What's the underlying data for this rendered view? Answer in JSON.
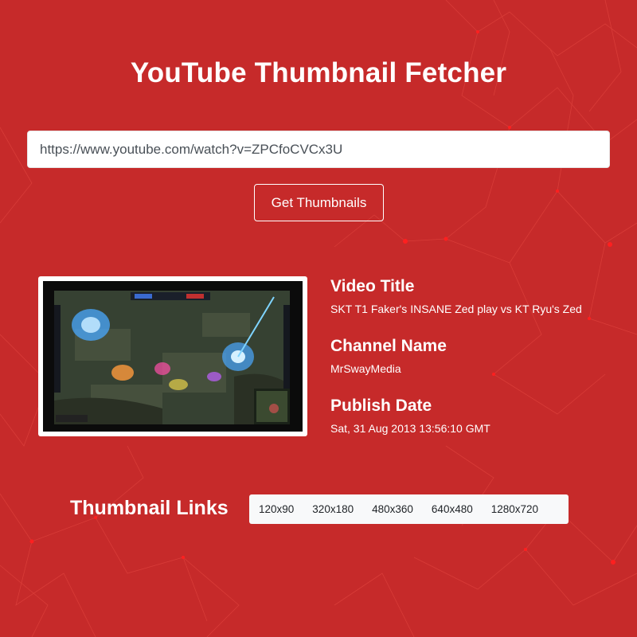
{
  "app": {
    "title": "YouTube Thumbnail Fetcher"
  },
  "form": {
    "url_value": "https://www.youtube.com/watch?v=ZPCfoCVCx3U",
    "submit_label": "Get Thumbnails"
  },
  "video": {
    "title_heading": "Video Title",
    "title": "SKT T1 Faker's INSANE Zed play vs KT Ryu's Zed",
    "channel_heading": "Channel Name",
    "channel": "MrSwayMedia",
    "date_heading": "Publish Date",
    "date": "Sat, 31 Aug 2013 13:56:10 GMT"
  },
  "thumbnails": {
    "heading": "Thumbnail Links",
    "links": [
      "120x90",
      "320x180",
      "480x360",
      "640x480",
      "1280x720"
    ]
  },
  "colors": {
    "background": "#c62a2a",
    "network_lines": "#e0403a",
    "network_nodes": "#ff1f1f",
    "links_bar": "#f8f9fa"
  },
  "icons": {
    "thumbnail": "league-of-legends-gameplay-image"
  }
}
